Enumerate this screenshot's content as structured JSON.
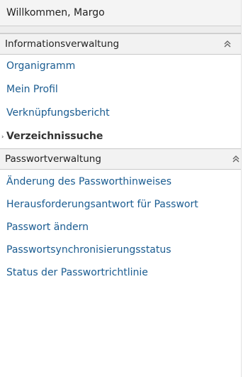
{
  "welcome": "Willkommen, Margo",
  "sections": [
    {
      "title": "Informationsverwaltung",
      "items": [
        {
          "label": "Organigramm"
        },
        {
          "label": "Mein Profil"
        },
        {
          "label": "Verknüpfungsbericht"
        },
        {
          "label": "Verzeichnissuche",
          "active": true
        }
      ]
    },
    {
      "title": "Passwortverwaltung",
      "items": [
        {
          "label": "Änderung des Passworthinweises"
        },
        {
          "label": "Herausforderungsantwort für Passwort"
        },
        {
          "label": "Passwort ändern"
        },
        {
          "label": "Passwortsynchronisierungsstatus"
        },
        {
          "label": "Status der Passwortrichtlinie"
        }
      ]
    }
  ],
  "colors": {
    "link": "#1a5c91",
    "header_bg": "#f2f2f2",
    "active_text": "#333333"
  },
  "icons": {
    "collapse": "double-chevron-up-icon",
    "active_marker": "bullet-arrow-icon"
  }
}
